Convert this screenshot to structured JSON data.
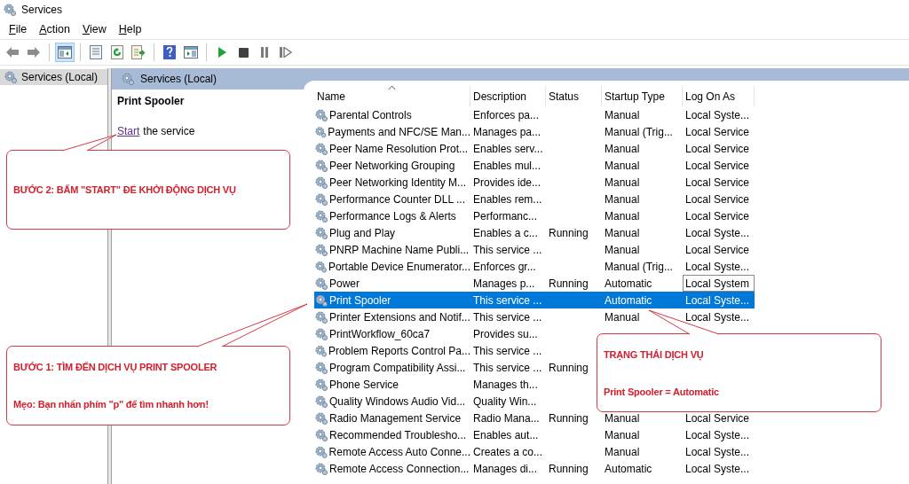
{
  "window": {
    "title": "Services"
  },
  "menu": [
    {
      "label": "File"
    },
    {
      "label": "Action"
    },
    {
      "label": "View"
    },
    {
      "label": "Help"
    }
  ],
  "toolbar": [
    {
      "buttons": [
        {
          "kind": "back",
          "pressed": false
        },
        {
          "kind": "forward",
          "pressed": false
        }
      ]
    },
    {
      "buttons": [
        {
          "kind": "tree",
          "pressed": true
        }
      ]
    },
    {
      "buttons": [
        {
          "kind": "properties",
          "pressed": false
        },
        {
          "kind": "refresh",
          "pressed": false
        },
        {
          "kind": "export",
          "pressed": false
        }
      ]
    },
    {
      "buttons": [
        {
          "kind": "help",
          "pressed": false
        },
        {
          "kind": "pane",
          "pressed": false
        }
      ]
    },
    {
      "buttons": [
        {
          "kind": "start",
          "pressed": false
        },
        {
          "kind": "stop",
          "pressed": false
        },
        {
          "kind": "pause",
          "pressed": false
        },
        {
          "kind": "resume",
          "pressed": false
        }
      ]
    }
  ],
  "tree": {
    "items": [
      {
        "label": "Services (Local)",
        "selected": true
      }
    ]
  },
  "pane": {
    "title": "Services (Local)",
    "service_name": "Print Spooler",
    "action_link": "Start",
    "action_text": "the service"
  },
  "table": {
    "columns": [
      {
        "label": "Name",
        "sorted": true
      },
      {
        "label": "Description",
        "sorted": false
      },
      {
        "label": "Status",
        "sorted": false
      },
      {
        "label": "Startup Type",
        "sorted": false
      },
      {
        "label": "Log On As",
        "sorted": false
      }
    ],
    "rows": [
      {
        "name": "Parental Controls",
        "description": "Enforces pa...",
        "startup": "Manual",
        "logon": "Local Syste...",
        "selected": false
      },
      {
        "name": "Payments and NFC/SE Man...",
        "description": "Manages pa...",
        "startup": "Manual (Trig...",
        "logon": "Local Service",
        "selected": false
      },
      {
        "name": "Peer Name Resolution Prot...",
        "description": "Enables serv...",
        "startup": "Manual",
        "logon": "Local Service",
        "selected": false
      },
      {
        "name": "Peer Networking Grouping",
        "description": "Enables mul...",
        "startup": "Manual",
        "logon": "Local Service",
        "selected": false
      },
      {
        "name": "Peer Networking Identity M...",
        "description": "Provides ide...",
        "startup": "Manual",
        "logon": "Local Service",
        "selected": false
      },
      {
        "name": "Performance Counter DLL ...",
        "description": "Enables rem...",
        "startup": "Manual",
        "logon": "Local Service",
        "selected": false
      },
      {
        "name": "Performance Logs & Alerts",
        "description": "Performanc...",
        "startup": "Manual",
        "logon": "Local Service",
        "selected": false
      },
      {
        "name": "Plug and Play",
        "description": "Enables a c...",
        "status": "Running",
        "startup": "Manual",
        "logon": "Local Syste...",
        "selected": false
      },
      {
        "name": "PNRP Machine Name Publi...",
        "description": "This service ...",
        "startup": "Manual",
        "logon": "Local Service",
        "selected": false
      },
      {
        "name": "Portable Device Enumerator...",
        "description": "Enforces gr...",
        "startup": "Manual (Trig...",
        "logon": "Local Syste...",
        "selected": false
      },
      {
        "name": "Power",
        "description": "Manages p...",
        "status": "Running",
        "startup": "Automatic",
        "logon": "Local System",
        "logon_focused": true,
        "selected": false
      },
      {
        "name": "Print Spooler",
        "description": "This service ...",
        "startup": "Automatic",
        "logon": "Local Syste...",
        "selected": true
      },
      {
        "name": "Printer Extensions and Notif...",
        "description": "This service ...",
        "startup": "Manual",
        "logon": "Local Syste...",
        "selected": false
      },
      {
        "name": "PrintWorkflow_60ca7",
        "description": "Provides su...",
        "selected": false
      },
      {
        "name": "Problem Reports Control Pa...",
        "description": "This service ...",
        "selected": false
      },
      {
        "name": "Program Compatibility Assi...",
        "description": "This service ...",
        "status": "Running",
        "selected": false
      },
      {
        "name": "Phone Service",
        "description": "Manages th...",
        "selected": false
      },
      {
        "name": "Quality Windows Audio Vid...",
        "description": "Quality Win...",
        "selected": false
      },
      {
        "name": "Radio Management Service",
        "description": "Radio Mana...",
        "status": "Running",
        "startup": "Manual",
        "logon": "Local Service",
        "selected": false
      },
      {
        "name": "Recommended Troublesho...",
        "description": "Enables aut...",
        "startup": "Manual",
        "logon": "Local Syste...",
        "selected": false
      },
      {
        "name": "Remote Access Auto Conne...",
        "description": "Creates a co...",
        "startup": "Manual",
        "logon": "Local Syste...",
        "selected": false
      },
      {
        "name": "Remote Access Connection...",
        "description": "Manages di...",
        "status": "Running",
        "startup": "Automatic",
        "logon": "Local Syste...",
        "selected": false
      }
    ]
  },
  "callouts": [
    {
      "lines": [
        "BƯỚC 2: BẤM \"START\" ĐỂ KHỞI ĐỘNG DỊCH VỤ"
      ]
    },
    {
      "lines": [
        "BƯỚC 1: TÌM ĐẾN DỊCH VỤ PRINT SPOOLER",
        "Mẹo: Bạn nhấn phím \"p\" để tìm nhanh hơn!"
      ]
    },
    {
      "lines": [
        "TRẠNG THÁI DỊCH VỤ",
        "Print Spooler = Automatic"
      ]
    }
  ]
}
